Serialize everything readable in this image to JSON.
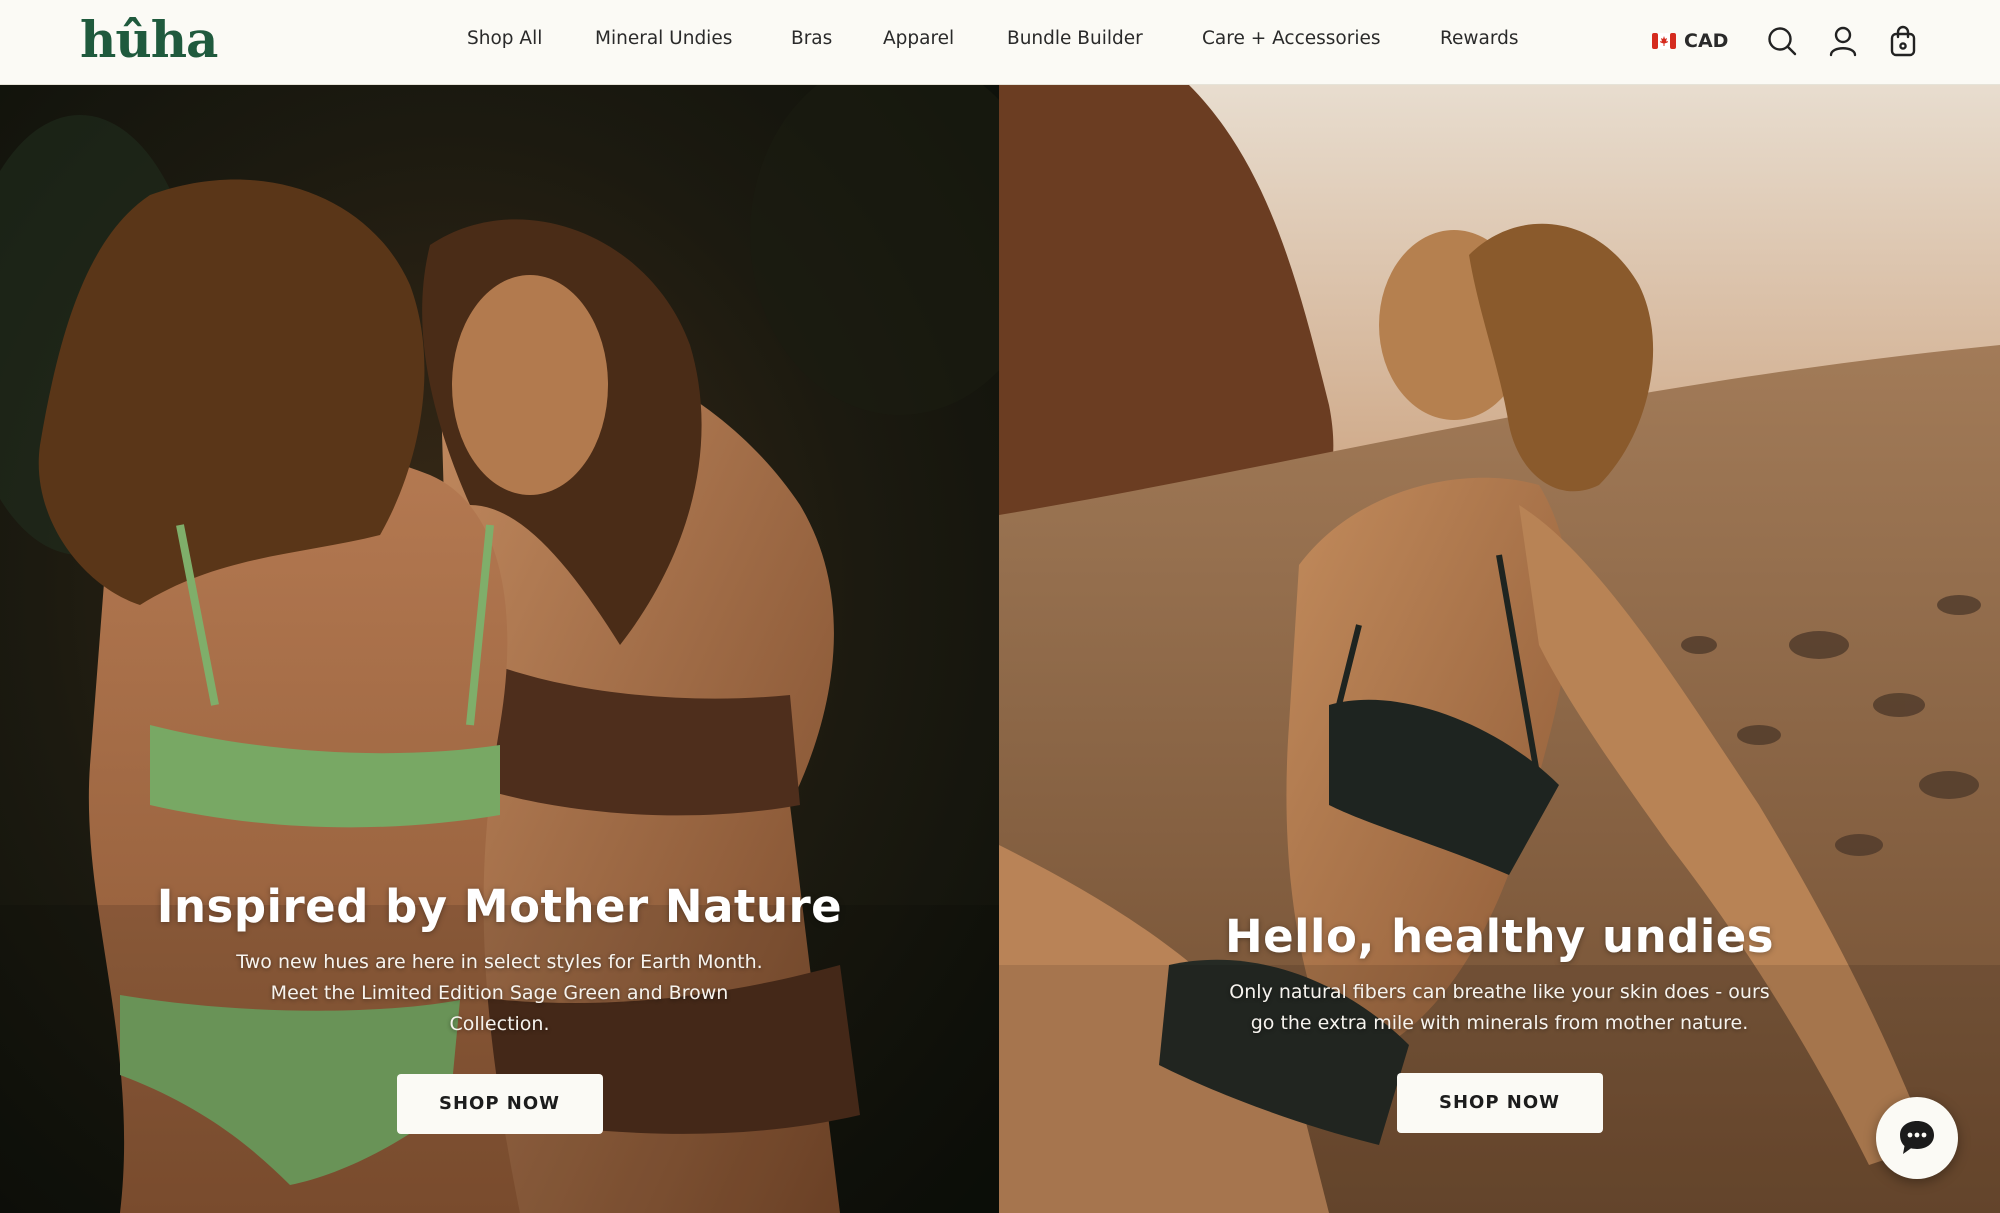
{
  "header": {
    "logo": "hûha",
    "nav": [
      "Shop All",
      "Mineral Undies",
      "Bras",
      "Apparel",
      "Bundle Builder",
      "Care + Accessories",
      "Rewards"
    ],
    "currency": "CAD",
    "icons": [
      "canada-flag-icon",
      "search-icon",
      "account-icon",
      "shopping-bag-icon"
    ]
  },
  "hero_left": {
    "title": "Inspired by Mother Nature",
    "text": "Two new hues are here in select styles for Earth Month. Meet the Limited Edition Sage Green and Brown Collection.",
    "button": "SHOP NOW"
  },
  "hero_right": {
    "title": "Hello, healthy undies",
    "text": "Only natural fibers can breathe like your skin does - ours go the extra mile with minerals from mother nature.",
    "button": "SHOP NOW"
  },
  "chat": {
    "icon": "chat-bubble-icon"
  },
  "colors": {
    "header_bg": "#fbfaf5",
    "logo": "#1f5a3d",
    "button_bg": "#fbfaf5",
    "button_text": "#1c1c1c"
  }
}
